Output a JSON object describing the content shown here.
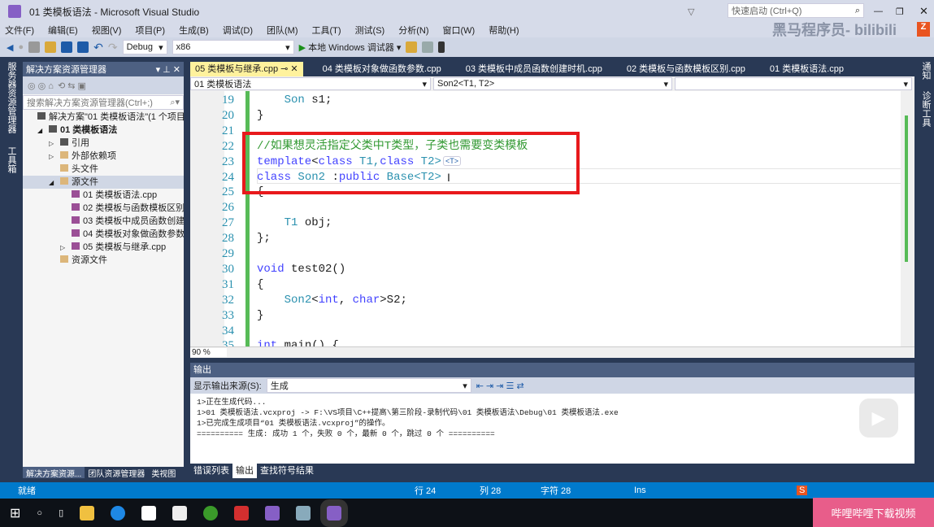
{
  "window": {
    "title": "01 类模板语法 - Microsoft Visual Studio",
    "quick_launch": "快速启动 (Ctrl+Q)"
  },
  "menu": [
    "文件(F)",
    "编辑(E)",
    "视图(V)",
    "项目(P)",
    "生成(B)",
    "调试(D)",
    "团队(M)",
    "工具(T)",
    "测试(S)",
    "分析(N)",
    "窗口(W)",
    "帮助(H)"
  ],
  "toolbar": {
    "config": "Debug",
    "platform": "x86",
    "run": "本地 Windows 调试器"
  },
  "left_strip": [
    "服务器资源管理器",
    "工具箱"
  ],
  "right_strip": [
    "通知",
    "诊断工具"
  ],
  "solution_explorer": {
    "title": "解决方案资源管理器",
    "search_placeholder": "搜索解决方案资源管理器(Ctrl+;)",
    "items": [
      {
        "label": "解决方案\"01 类模板语法\"(1 个项目)",
        "level": 0,
        "icon": "solution-icon"
      },
      {
        "label": "01 类模板语法",
        "level": 1,
        "icon": "project-icon",
        "expanded": true
      },
      {
        "label": "引用",
        "level": 2,
        "icon": "references-icon",
        "collapsed": true
      },
      {
        "label": "外部依赖项",
        "level": 2,
        "icon": "folder-icon",
        "collapsed": true
      },
      {
        "label": "头文件",
        "level": 2,
        "icon": "folder-icon"
      },
      {
        "label": "源文件",
        "level": 2,
        "icon": "folder-icon",
        "expanded": true,
        "selected": true
      },
      {
        "label": "01 类模板语法.cpp",
        "level": 3,
        "icon": "cpp-file-icon"
      },
      {
        "label": "02 类模板与函数模板区别.cpp",
        "level": 3,
        "icon": "cpp-file-icon"
      },
      {
        "label": "03 类模板中成员函数创建时机.cpp",
        "level": 3,
        "icon": "cpp-file-icon"
      },
      {
        "label": "04 类模板对象做函数参数.cpp",
        "level": 3,
        "icon": "cpp-file-icon"
      },
      {
        "label": "05 类模板与继承.cpp",
        "level": 3,
        "icon": "cpp-file-icon",
        "collapsed": true
      },
      {
        "label": "资源文件",
        "level": 2,
        "icon": "folder-icon"
      }
    ],
    "tabs": [
      "解决方案资源...",
      "团队资源管理器",
      "类视图"
    ]
  },
  "editor": {
    "tabs": [
      "05 类模板与继承.cpp",
      "04 类模板对象做函数参数.cpp",
      "03 类模板中成员函数创建时机.cpp",
      "02 类模板与函数模板区别.cpp",
      "01 类模板语法.cpp"
    ],
    "nav_project": "01 类模板语法",
    "nav_scope": "Son2<T1, T2>",
    "zoom": "90 %",
    "hint": "<T>",
    "lines": [
      {
        "n": "19",
        "t": [
          [
            "    ",
            "pl"
          ],
          [
            "Son",
            "ty"
          ],
          [
            " s1;",
            "pl"
          ]
        ]
      },
      {
        "n": "20",
        "t": [
          [
            "}",
            "pl"
          ]
        ]
      },
      {
        "n": "21",
        "t": []
      },
      {
        "n": "22",
        "t": [
          [
            "//如果想灵活指定父类中T类型，子类也需要变类模板",
            "cm"
          ]
        ]
      },
      {
        "n": "23",
        "t": [
          [
            "template",
            "kw"
          ],
          [
            "<",
            "pl"
          ],
          [
            "class",
            "kw"
          ],
          [
            " T1,",
            "ty"
          ],
          [
            "class",
            "kw"
          ],
          [
            " T2>",
            "ty"
          ]
        ]
      },
      {
        "n": "24",
        "t": [
          [
            "class",
            "kw"
          ],
          [
            " Son2 ",
            "ty"
          ],
          [
            ":",
            "pl"
          ],
          [
            "public",
            "kw"
          ],
          [
            " Base",
            "ty"
          ],
          [
            "<T2>",
            "ty"
          ]
        ]
      },
      {
        "n": "25",
        "t": [
          [
            "{",
            "pl"
          ]
        ]
      },
      {
        "n": "26",
        "t": []
      },
      {
        "n": "27",
        "t": [
          [
            "    ",
            "pl"
          ],
          [
            "T1",
            "ty"
          ],
          [
            " obj;",
            "pl"
          ]
        ]
      },
      {
        "n": "28",
        "t": [
          [
            "};",
            "pl"
          ]
        ]
      },
      {
        "n": "29",
        "t": []
      },
      {
        "n": "30",
        "t": [
          [
            "void",
            "kw"
          ],
          [
            " test02()",
            "pl"
          ]
        ]
      },
      {
        "n": "31",
        "t": [
          [
            "{",
            "pl"
          ]
        ]
      },
      {
        "n": "32",
        "t": [
          [
            "    ",
            "pl"
          ],
          [
            "Son2",
            "ty"
          ],
          [
            "<",
            "pl"
          ],
          [
            "int",
            "kw"
          ],
          [
            ", ",
            "pl"
          ],
          [
            "char",
            "kw"
          ],
          [
            ">S2;",
            "pl"
          ]
        ]
      },
      {
        "n": "33",
        "t": [
          [
            "}",
            "pl"
          ]
        ]
      },
      {
        "n": "34",
        "t": []
      },
      {
        "n": "35",
        "t": [
          [
            "int",
            "kw"
          ],
          [
            " main() {",
            "pl"
          ]
        ]
      }
    ]
  },
  "output": {
    "title": "输出",
    "source_label": "显示输出来源(S):",
    "source": "生成",
    "lines": [
      "1>正在生成代码...",
      "1>01 类模板语法.vcxproj -> F:\\VS项目\\C++提高\\第三阶段-录制代码\\01 类模板语法\\Debug\\01 类模板语法.exe",
      "1>已完成生成项目“01 类模板语法.vcxproj”的操作。",
      "========== 生成: 成功 1 个，失败 0 个，最新 0 个，跳过 0 个 =========="
    ],
    "tabs": [
      "错误列表",
      "输出",
      "查找符号结果"
    ]
  },
  "status": {
    "ready": "就绪",
    "line": "行 24",
    "col": "列 28",
    "char": "字符 28",
    "mode": "Ins"
  },
  "overlay": {
    "watermark": "黑马程序员- bilibili",
    "bili_banner": "哔哩哔哩下载视频"
  },
  "colors": {
    "accent": "#007acc",
    "highlight_box": "#e8191c",
    "active_tab": "#fff29d"
  }
}
